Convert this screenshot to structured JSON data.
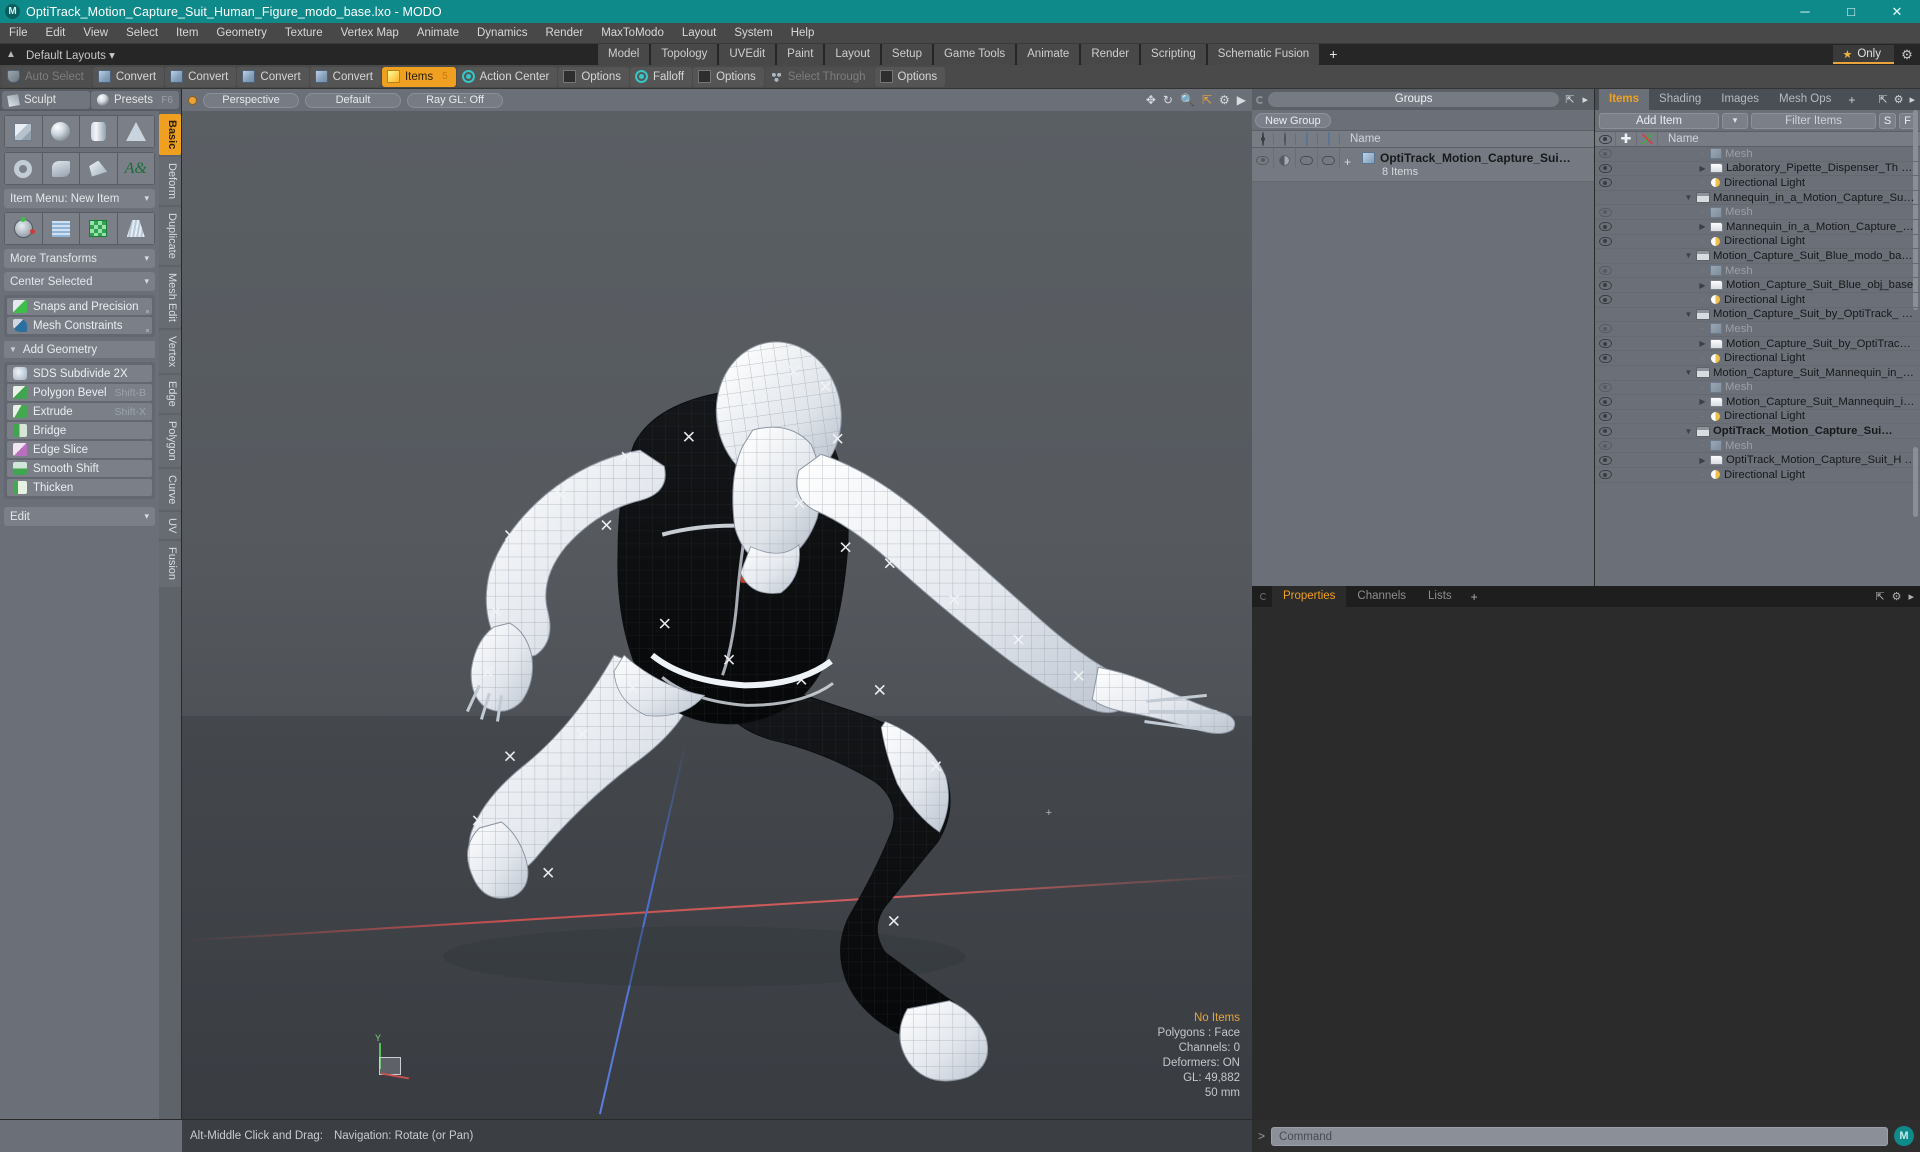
{
  "titlebar": {
    "app_icon": "modo-logo-icon",
    "title": "OptiTrack_Motion_Capture_Suit_Human_Figure_modo_base.lxo - MODO",
    "minimize": "─",
    "maximize": "□",
    "close": "✕",
    "accent_color": "#0e8a8a"
  },
  "menubar": {
    "items": [
      "File",
      "Edit",
      "View",
      "Select",
      "Item",
      "Geometry",
      "Texture",
      "Vertex Map",
      "Animate",
      "Dynamics",
      "Render",
      "MaxToModo",
      "Layout",
      "System",
      "Help"
    ]
  },
  "layoutbar": {
    "up_arrow": "▲",
    "default_layouts": "Default Layouts",
    "default_caret": "▾",
    "tabs": [
      "Model",
      "Topology",
      "UVEdit",
      "Paint",
      "Layout",
      "Setup",
      "Game Tools",
      "Animate",
      "Render",
      "Scripting",
      "Schematic Fusion"
    ],
    "plus": "+",
    "only_label": "Only",
    "star": "★",
    "gear": "⚙",
    "accent_color": "#e8a33d"
  },
  "toolbar": {
    "items": [
      {
        "label": "Auto Select",
        "icon": "shield-icon",
        "state": "dim"
      },
      {
        "label": "Convert",
        "icon": "convert-vertex-icon",
        "state": "normal"
      },
      {
        "label": "Convert",
        "icon": "convert-edge-icon",
        "state": "normal"
      },
      {
        "label": "Convert",
        "icon": "convert-polygon-icon",
        "state": "normal"
      },
      {
        "label": "Convert",
        "icon": "convert-material-icon",
        "state": "normal"
      },
      {
        "label": "Items",
        "icon": "items-cube-icon",
        "state": "active",
        "hotkey": "5"
      },
      {
        "label": "Action Center",
        "icon": "action-center-icon",
        "state": "normal"
      },
      {
        "label": "Options",
        "icon": "options-square-icon",
        "state": "normal"
      },
      {
        "label": "Falloff",
        "icon": "falloff-icon",
        "state": "normal"
      },
      {
        "label": "Options",
        "icon": "options-square-icon",
        "state": "normal"
      },
      {
        "label": "Select Through",
        "icon": "select-through-icon",
        "state": "dim"
      },
      {
        "label": "Options",
        "icon": "options-square-icon",
        "state": "normal"
      }
    ]
  },
  "left_panel": {
    "sculpt": "Sculpt",
    "presets": "Presets",
    "presets_key": "F6",
    "primitives_row1": [
      "cube-icon",
      "sphere-icon",
      "cylinder-icon",
      "cone-icon"
    ],
    "primitives_row2": [
      "torus-icon",
      "spiral-icon",
      "polygon-icon",
      "text-icon"
    ],
    "item_menu": "Item Menu: New Item",
    "transform_row": [
      "transform-gizmo-icon",
      "grid-icon",
      "checker-icon",
      "taper-icon"
    ],
    "more_transforms": "More Transforms",
    "center_selected": "Center Selected",
    "snaps": "Snaps and Precision",
    "mesh_constraints": "Mesh Constraints",
    "add_geometry": "Add Geometry",
    "geometry_ops": [
      {
        "label": "SDS Subdivide 2X",
        "shortcut": "",
        "icon": "sds-subdivide-icon"
      },
      {
        "label": "Polygon Bevel",
        "shortcut": "Shift-B",
        "icon": "polygon-bevel-icon"
      },
      {
        "label": "Extrude",
        "shortcut": "Shift-X",
        "icon": "extrude-icon"
      },
      {
        "label": "Bridge",
        "shortcut": "",
        "icon": "bridge-icon"
      },
      {
        "label": "Edge Slice",
        "shortcut": "",
        "icon": "edge-slice-icon"
      },
      {
        "label": "Smooth Shift",
        "shortcut": "",
        "icon": "smooth-shift-icon"
      },
      {
        "label": "Thicken",
        "shortcut": "",
        "icon": "thicken-icon"
      }
    ],
    "edit": "Edit",
    "vertical_tabs": [
      "Basic",
      "Deform",
      "Duplicate",
      "Mesh Edit",
      "Vertex",
      "Edge",
      "Polygon",
      "Curve",
      "UV",
      "Fusion"
    ],
    "active_vertical_tab": "Basic"
  },
  "viewport": {
    "view_mode": "Perspective",
    "shading": "Default",
    "raygl": "Ray GL: Off",
    "header_icons": [
      "move-icon",
      "rotate-icon",
      "zoom-icon",
      "fit-icon",
      "gear-icon",
      "arrow-right-icon"
    ],
    "status": {
      "selection": "No Items",
      "polygons": "Polygons : Face",
      "channels": "Channels: 0",
      "deformers": "Deformers: ON",
      "gl": "GL: 49,882",
      "scale": "50 mm"
    },
    "axis_label_y": "Y"
  },
  "groups_panel": {
    "title": "Groups",
    "new_group": "New Group",
    "columns": [
      "visibility-eye",
      "shading-halfmoon",
      "render-cube",
      "lock-cube",
      "Name"
    ],
    "name_column": "Name",
    "rows": [
      {
        "name": "OptiTrack_Motion_Capture_Sui…",
        "subtitle": "8 Items",
        "expander": "+"
      }
    ]
  },
  "items_panel": {
    "tabs": [
      "Items",
      "Shading",
      "Images",
      "Mesh Ops"
    ],
    "active_tab": "Items",
    "tab_plus": "+",
    "add_item": "Add Item",
    "dropdown_caret": "▾",
    "filter_placeholder": "Filter Items",
    "btn_s": "S",
    "btn_f": "F",
    "name_column": "Name",
    "tree": [
      {
        "label": "Mesh",
        "type": "mesh",
        "depth": 1,
        "twirl": "leaf",
        "dim": true,
        "eye": true,
        "bold": false
      },
      {
        "label": "Laboratory_Pipette_Dispenser_Th …",
        "type": "folder",
        "depth": 1,
        "twirl": "closed",
        "dim": false,
        "eye": true,
        "bold": false
      },
      {
        "label": "Directional Light",
        "type": "light",
        "depth": 1,
        "twirl": "leaf",
        "dim": false,
        "eye": true,
        "bold": false
      },
      {
        "label": "Mannequin_in_a_Motion_Capture_Su…",
        "type": "group",
        "depth": 0,
        "twirl": "open",
        "dim": false,
        "eye": false,
        "bold": false
      },
      {
        "label": "Mesh",
        "type": "mesh",
        "depth": 1,
        "twirl": "leaf",
        "dim": true,
        "eye": true,
        "bold": false
      },
      {
        "label": "Mannequin_in_a_Motion_Capture_…",
        "type": "folder",
        "depth": 1,
        "twirl": "closed",
        "dim": false,
        "eye": true,
        "bold": false
      },
      {
        "label": "Directional Light",
        "type": "light",
        "depth": 1,
        "twirl": "leaf",
        "dim": false,
        "eye": true,
        "bold": false
      },
      {
        "label": "Motion_Capture_Suit_Blue_modo_ba…",
        "type": "group",
        "depth": 0,
        "twirl": "open",
        "dim": false,
        "eye": false,
        "bold": false
      },
      {
        "label": "Mesh",
        "type": "mesh",
        "depth": 1,
        "twirl": "leaf",
        "dim": true,
        "eye": true,
        "bold": false
      },
      {
        "label": "Motion_Capture_Suit_Blue_obj_base",
        "type": "folder",
        "depth": 1,
        "twirl": "closed",
        "dim": false,
        "eye": true,
        "bold": false
      },
      {
        "label": "Directional Light",
        "type": "light",
        "depth": 1,
        "twirl": "leaf",
        "dim": false,
        "eye": true,
        "bold": false
      },
      {
        "label": "Motion_Capture_Suit_by_OptiTrack_ …",
        "type": "group",
        "depth": 0,
        "twirl": "open",
        "dim": false,
        "eye": false,
        "bold": false
      },
      {
        "label": "Mesh",
        "type": "mesh",
        "depth": 1,
        "twirl": "leaf",
        "dim": true,
        "eye": true,
        "bold": false
      },
      {
        "label": "Motion_Capture_Suit_by_OptiTrac…",
        "type": "folder",
        "depth": 1,
        "twirl": "closed",
        "dim": false,
        "eye": true,
        "bold": false
      },
      {
        "label": "Directional Light",
        "type": "light",
        "depth": 1,
        "twirl": "leaf",
        "dim": false,
        "eye": true,
        "bold": false
      },
      {
        "label": "Motion_Capture_Suit_Mannequin_in_…",
        "type": "group",
        "depth": 0,
        "twirl": "open",
        "dim": false,
        "eye": false,
        "bold": false
      },
      {
        "label": "Mesh",
        "type": "mesh",
        "depth": 1,
        "twirl": "leaf",
        "dim": true,
        "eye": true,
        "bold": false
      },
      {
        "label": "Motion_Capture_Suit_Mannequin_i…",
        "type": "folder",
        "depth": 1,
        "twirl": "closed",
        "dim": false,
        "eye": true,
        "bold": false
      },
      {
        "label": "Directional Light",
        "type": "light",
        "depth": 1,
        "twirl": "leaf",
        "dim": false,
        "eye": true,
        "bold": false
      },
      {
        "label": "OptiTrack_Motion_Capture_Sui…",
        "type": "group",
        "depth": 0,
        "twirl": "open",
        "dim": false,
        "eye": true,
        "bold": true
      },
      {
        "label": "Mesh",
        "type": "mesh",
        "depth": 1,
        "twirl": "leaf",
        "dim": true,
        "eye": true,
        "bold": false
      },
      {
        "label": "OptiTrack_Motion_Capture_Suit_H …",
        "type": "folder",
        "depth": 1,
        "twirl": "closed",
        "dim": false,
        "eye": true,
        "bold": false
      },
      {
        "label": "Directional Light",
        "type": "light",
        "depth": 1,
        "twirl": "leaf",
        "dim": false,
        "eye": true,
        "bold": false
      }
    ]
  },
  "properties_panel": {
    "tabs": [
      "Properties",
      "Channels",
      "Lists"
    ],
    "active_tab": "Properties",
    "plus": "+"
  },
  "bottom": {
    "hint_key": "Alt-Middle Click and Drag:",
    "hint_action": "Navigation: Rotate (or Pan)",
    "command_prompt": ">",
    "command_placeholder": "Command",
    "logo": "modo-logo-icon"
  }
}
